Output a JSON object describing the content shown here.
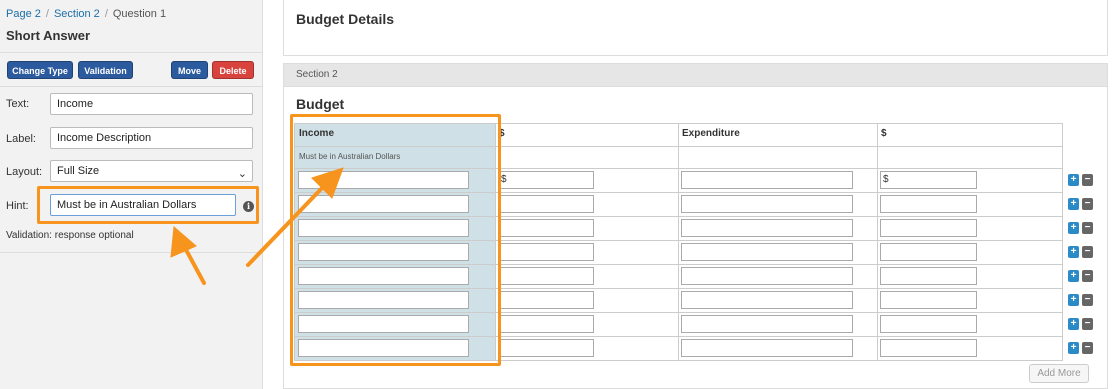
{
  "breadcrumb": {
    "page": "Page 2",
    "section": "Section 2",
    "question": "Question 1",
    "separator": "/"
  },
  "panel_title": "Short Answer",
  "toolbar": {
    "change_type": "Change Type",
    "validation": "Validation",
    "move": "Move",
    "delete": "Delete"
  },
  "form": {
    "text_label": "Text:",
    "text_value": "Income",
    "label_label": "Label:",
    "label_value": "Income Description",
    "layout_label": "Layout:",
    "layout_value": "Full Size",
    "hint_label": "Hint:",
    "hint_value": "Must be in Australian Dollars",
    "validation_text": "Validation: response optional"
  },
  "card1_title": "Budget Details",
  "section_header": "Section 2",
  "budget_title": "Budget",
  "table": {
    "headers": [
      "Income",
      "$",
      "Expenditure",
      "$"
    ],
    "income_hint": "Must be in Australian Dollars",
    "first_row_prefix": "$"
  },
  "add_more": "Add More",
  "colors": {
    "accent_orange": "#f7941d",
    "primary_blue": "#2b5a9e",
    "danger_red": "#d9433d",
    "highlight_col": "#cfe0e6"
  }
}
